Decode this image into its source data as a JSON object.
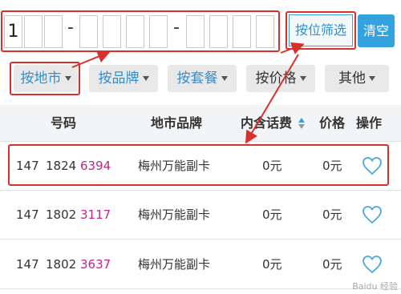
{
  "digit_filter": {
    "digits": [
      "1",
      "",
      "",
      "",
      "",
      "",
      "",
      "",
      "",
      "",
      ""
    ],
    "separator": "-",
    "filter_button": "按位筛选",
    "clear_button": "清空"
  },
  "dropdowns": [
    {
      "label": "按地市",
      "active": true
    },
    {
      "label": "按品牌",
      "active": false
    },
    {
      "label": "按套餐",
      "active": false
    },
    {
      "label": "按价格",
      "active": false
    },
    {
      "label": "其他",
      "active": false
    }
  ],
  "table": {
    "headers": {
      "number": "号码",
      "brand": "地市品牌",
      "credit": "内含话费",
      "price": "价格",
      "action": "操作"
    },
    "rows": [
      {
        "prefix": "147",
        "middle": "1824",
        "tail": "6394",
        "brand": "梅州万能副卡",
        "credit": "0元",
        "price": "0元"
      },
      {
        "prefix": "147",
        "middle": "1802",
        "tail": "3117",
        "brand": "梅州万能副卡",
        "credit": "0元",
        "price": "0元"
      },
      {
        "prefix": "147",
        "middle": "1802",
        "tail": "3637",
        "brand": "梅州万能副卡",
        "credit": "0元",
        "price": "0元"
      }
    ]
  },
  "colors": {
    "accent": "#2f8fd1",
    "highlight": "#d9302c",
    "number_tail": "#c0258a",
    "header_bg": "#f2f4f6"
  },
  "icons": {
    "sort": "sort-icon",
    "favorite": "heart-icon"
  },
  "watermark": "Baidu 经验"
}
